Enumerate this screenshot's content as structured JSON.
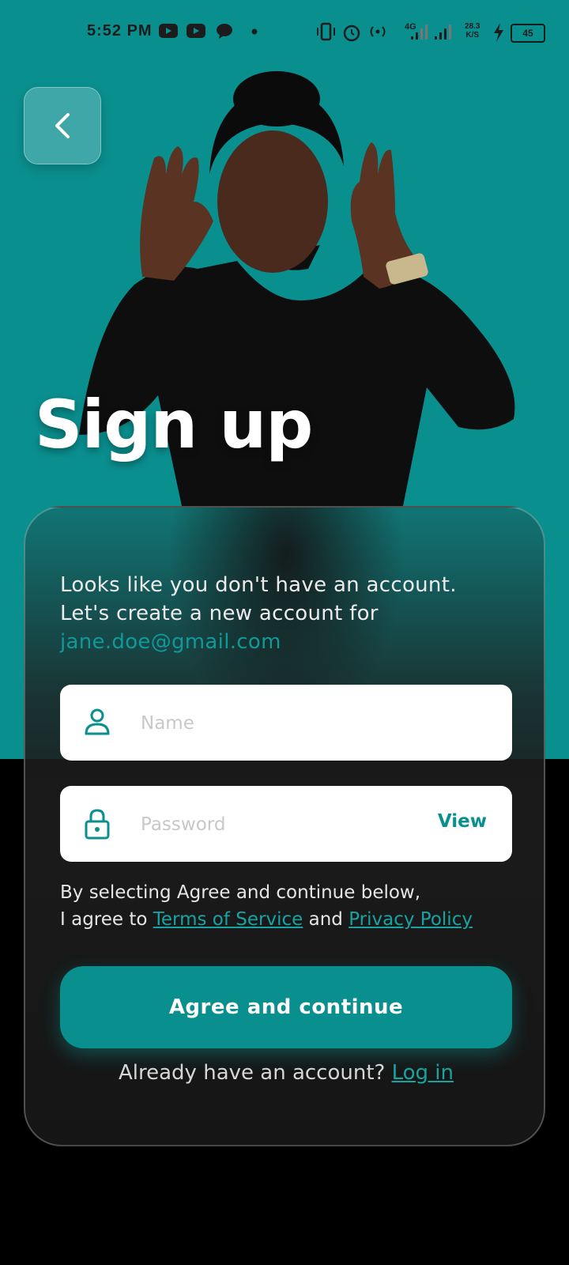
{
  "status_bar": {
    "time": "5:52 PM",
    "network_type": "4G",
    "net_speed_value": "28.3",
    "net_speed_unit": "K/S",
    "battery": "45",
    "icons": [
      "youtube-icon",
      "youtube-icon",
      "chat-icon",
      "dot-icon",
      "vibrate-icon",
      "alarm-icon",
      "hotspot-icon",
      "signal-icon",
      "signal-icon",
      "charging-icon",
      "battery-icon"
    ]
  },
  "header": {
    "back_icon": "chevron-left-icon",
    "title": "Sign up"
  },
  "intro": {
    "line1": "Looks like you don't have an account.",
    "line2": "Let's create a new account for",
    "email": "jane.doe@gmail.com"
  },
  "form": {
    "name_placeholder": "Name",
    "name_icon": "user-icon",
    "password_placeholder": "Password",
    "password_icon": "lock-icon",
    "view_label": "View"
  },
  "terms": {
    "line1": "By selecting Agree and continue below,",
    "prefix": "I agree to ",
    "tos_link": "Terms of Service",
    "and": " and ",
    "privacy_link": "Privacy Policy"
  },
  "primary_button": "Agree and continue",
  "login": {
    "prompt": "Already have an account? ",
    "link": "Log in"
  },
  "colors": {
    "accent": "#0a8f8f",
    "background_top": "#0a8f8f",
    "background_bottom": "#000000",
    "card": "#1a1a1a"
  }
}
